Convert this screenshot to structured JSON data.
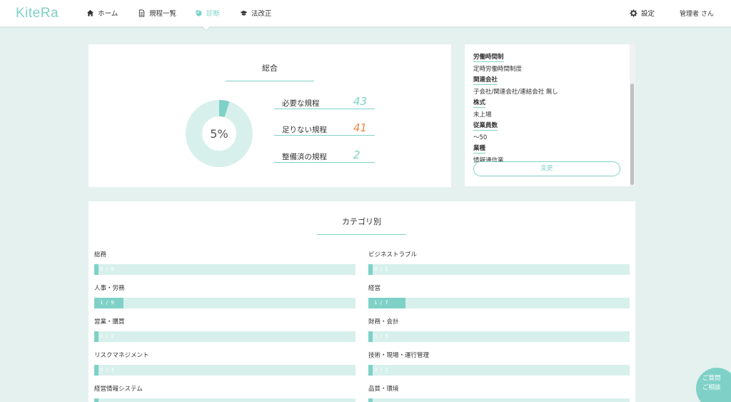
{
  "app": {
    "logo": "KiteRa"
  },
  "nav": [
    {
      "label": "ホーム",
      "icon": "home-icon"
    },
    {
      "label": "規程一覧",
      "icon": "document-icon"
    },
    {
      "label": "診断",
      "icon": "pie-chart-icon"
    },
    {
      "label": "法改正",
      "icon": "graduation-cap-icon"
    }
  ],
  "header": {
    "settings_label": "設定",
    "user_label": "管理者 さん"
  },
  "summary": {
    "title": "総合",
    "percent_label": "5%",
    "percent": 5,
    "stats": [
      {
        "label": "必要な規程",
        "value": "43"
      },
      {
        "label": "足りない規程",
        "value": "41"
      },
      {
        "label": "整備済の規程",
        "value": "2"
      }
    ]
  },
  "profile": {
    "fields": [
      {
        "label": "労働時間制",
        "value": "定時労働時間制度"
      },
      {
        "label": "関連会社",
        "value": "子会社/関連会社/連結会社 無し"
      },
      {
        "label": "株式",
        "value": "未上場"
      },
      {
        "label": "従業員数",
        "value": "〜50"
      },
      {
        "label": "業種",
        "value": "情報通信業"
      }
    ],
    "change_label": "変更"
  },
  "categories": {
    "title": "カテゴリ別",
    "items": [
      {
        "name": "総務",
        "count": "0 / 8",
        "fraction": 0
      },
      {
        "name": "ビジネストラブル",
        "count": "0 / 1",
        "fraction": 0
      },
      {
        "name": "人事・労務",
        "count": "1 / 9",
        "fraction": 0.111
      },
      {
        "name": "経営",
        "count": "1 / 7",
        "fraction": 0.143
      },
      {
        "name": "営業・購買",
        "count": "0 / 2",
        "fraction": 0
      },
      {
        "name": "財務・会計",
        "count": "0 / 5",
        "fraction": 0
      },
      {
        "name": "リスクマネジメント",
        "count": "0 / 3",
        "fraction": 0
      },
      {
        "name": "技術・現場・運行管理",
        "count": "0 / 2",
        "fraction": 0
      },
      {
        "name": "経営情報システム",
        "count": "",
        "fraction": 0
      },
      {
        "name": "品質・環境",
        "count": "",
        "fraction": 0
      }
    ]
  },
  "help": {
    "line1": "ご質問",
    "line2": "ご相談"
  },
  "colors": {
    "accent": "#7fd1c7",
    "accent_light": "#d7f0ec",
    "warning": "#e9884b",
    "background": "#e4f1ee"
  }
}
